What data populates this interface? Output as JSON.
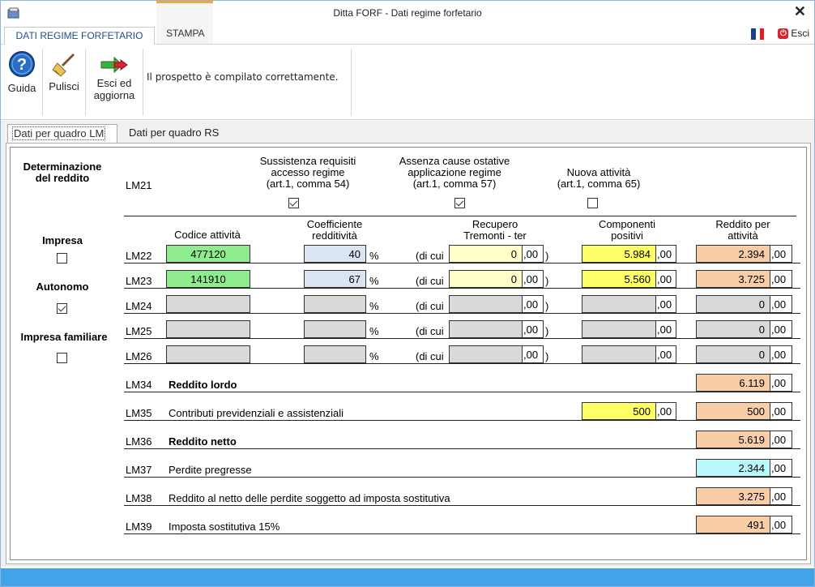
{
  "window": {
    "title": "Ditta FORF - Dati regime forfetario",
    "close_glyph": "✕"
  },
  "ribbon_tabs": [
    {
      "label": "DATI REGIME FORFETARIO",
      "active": true
    },
    {
      "label": "STAMPA",
      "active": false
    }
  ],
  "top_right": {
    "flag_icon": "flag-fr-icon",
    "esci_label": "Esci"
  },
  "toolbar": {
    "guida_label": "Guida",
    "pulisci_label": "Pulisci",
    "esci_aggiorna_label_1": "Esci ed",
    "esci_aggiorna_label_2": "aggiorna",
    "message": "Il prospetto è compilato correttamente."
  },
  "subtabs": [
    {
      "label": "Dati per quadro LM",
      "active": true
    },
    {
      "label": "Dati per quadro RS",
      "active": false
    }
  ],
  "left": {
    "determinazione_1": "Determinazione",
    "determinazione_2": "del reddito",
    "impresa": "Impresa",
    "impresa_checked": false,
    "autonomo": "Autonomo",
    "autonomo_checked": true,
    "impresa_familiare": "Impresa familiare",
    "impresa_familiare_checked": false
  },
  "lm21": {
    "code": "LM21",
    "col1_1": "Sussistenza requisiti",
    "col1_2": "accesso regime",
    "col1_3": "(art.1, comma 54)",
    "col1_checked": true,
    "col2_1": "Assenza cause ostative",
    "col2_2": "applicazione regime",
    "col2_3": "(art.1, comma 57)",
    "col2_checked": true,
    "col3_1": "Nuova attività",
    "col3_2": "(art.1, comma 65)",
    "col3_checked": false
  },
  "headers": {
    "codice": "Codice attività",
    "coeff_1": "Coefficiente",
    "coeff_2": "redditività",
    "recupero_1": "Recupero",
    "recupero_2": "Tremonti - ter",
    "componenti_1": "Componenti",
    "componenti_2": "positivi",
    "reddito_1": "Reddito per",
    "reddito_2": "attività"
  },
  "symbols": {
    "percent": "%",
    "di_cui": "(di cui",
    "close_paren": ")",
    "decimals": ",00"
  },
  "activity_rows": [
    {
      "code": "LM22",
      "codice": "477120",
      "coeff": "40",
      "recupero": "0",
      "componenti": "5.984",
      "reddito": "2.394",
      "filled": true
    },
    {
      "code": "LM23",
      "codice": "141910",
      "coeff": "67",
      "recupero": "0",
      "componenti": "5.560",
      "reddito": "3.725",
      "filled": true
    },
    {
      "code": "LM24",
      "codice": "",
      "coeff": "",
      "recupero": "",
      "componenti": "",
      "reddito": "0",
      "filled": false
    },
    {
      "code": "LM25",
      "codice": "",
      "coeff": "",
      "recupero": "",
      "componenti": "",
      "reddito": "0",
      "filled": false
    },
    {
      "code": "LM26",
      "codice": "",
      "coeff": "",
      "recupero": "",
      "componenti": "",
      "reddito": "0",
      "filled": false
    }
  ],
  "summary_rows": [
    {
      "code": "LM34",
      "label": "Reddito lordo",
      "bold": true,
      "value": "6.119",
      "extra": ""
    },
    {
      "code": "LM35",
      "label": "Contributi previdenziali e assistenziali",
      "bold": false,
      "value": "500",
      "extra": "500"
    },
    {
      "code": "LM36",
      "label": "Reddito netto",
      "bold": true,
      "value": "5.619",
      "extra": ""
    },
    {
      "code": "LM37",
      "label": "Perdite pregresse",
      "bold": false,
      "value": "2.344",
      "extra": ""
    },
    {
      "code": "LM38",
      "label": "Reddito al netto delle perdite soggetto ad imposta sostitutiva",
      "bold": false,
      "value": "3.275",
      "extra": ""
    },
    {
      "code": "LM39",
      "label": "Imposta sostitutiva 15%",
      "bold": false,
      "value": "491",
      "extra": ""
    }
  ],
  "colors": {
    "accent": "#1f4e8c",
    "statusbar": "#41a4e8",
    "green": "#8fec8f",
    "peach": "#f9cda8",
    "cyan": "#b9f7fb",
    "yellow": "#ffff66"
  }
}
